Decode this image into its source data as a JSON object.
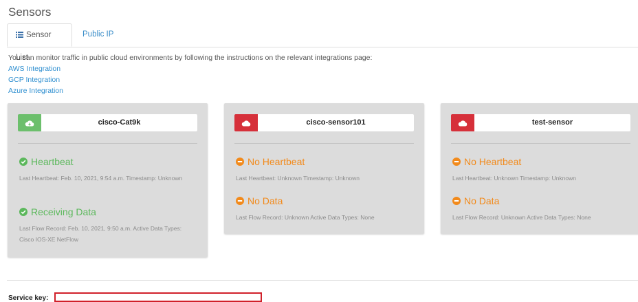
{
  "page": {
    "title": "Sensors"
  },
  "tabs": [
    {
      "label": "Sensor List",
      "active": true
    },
    {
      "label": "Public IP",
      "active": false
    }
  ],
  "intro": "You can monitor traffic in public cloud environments by following the instructions on the relevant integrations page:",
  "integrations": [
    "AWS Integration",
    "GCP Integration",
    "Azure Integration"
  ],
  "sensors": [
    {
      "name": "cisco-Cat9k",
      "color": "#6cbf6c",
      "heartbeat": {
        "label": "Heartbeat",
        "state": "ok",
        "detail": "Last Heartbeat: Feb. 10, 2021, 9:54 a.m. Timestamp: Unknown"
      },
      "data": {
        "label": "Receiving Data",
        "state": "ok",
        "detail": "Last Flow Record: Feb. 10, 2021, 9:50 a.m. Active Data Types: Cisco IOS-XE NetFlow"
      }
    },
    {
      "name": "cisco-sensor101",
      "color": "#d6303a",
      "heartbeat": {
        "label": "No Heartbeat",
        "state": "warn",
        "detail": "Last Heartbeat: Unknown Timestamp: Unknown"
      },
      "data": {
        "label": "No Data",
        "state": "warn",
        "detail": "Last Flow Record: Unknown Active Data Types: None"
      }
    },
    {
      "name": "test-sensor",
      "color": "#d6303a",
      "heartbeat": {
        "label": "No Heartbeat",
        "state": "warn",
        "detail": "Last Heartbeat: Unknown Timestamp: Unknown"
      },
      "data": {
        "label": "No Data",
        "state": "warn",
        "detail": "Last Flow Record: Unknown Active Data Types: None"
      }
    }
  ],
  "service_key": {
    "label": "Service key:",
    "value": ""
  },
  "colors": {
    "ok": "#5cb85c",
    "warn": "#f28a1b",
    "link": "#2f8fd0",
    "highlight": "#d0202a"
  },
  "icons": {
    "list": "list-icon",
    "cloud": "cloud-icon",
    "check": "check-circle-icon",
    "minus": "minus-circle-icon"
  }
}
